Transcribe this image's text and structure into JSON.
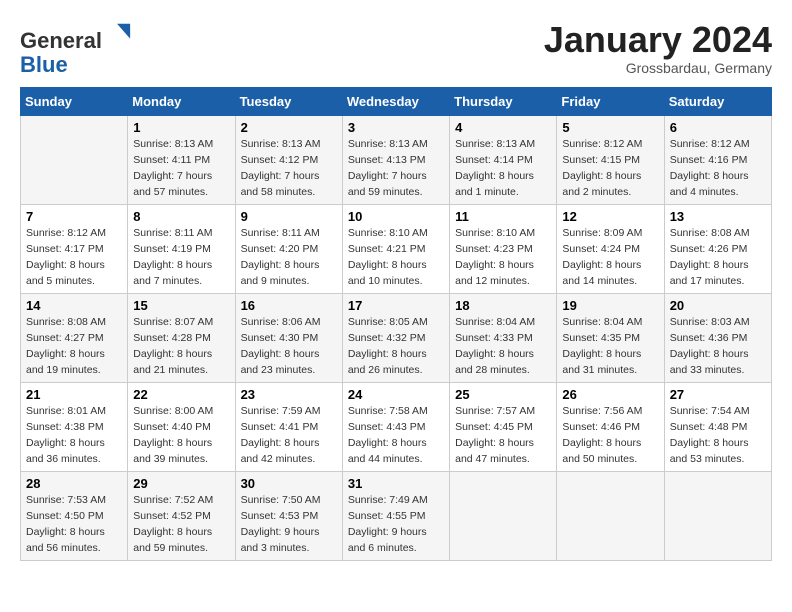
{
  "header": {
    "logo_general": "General",
    "logo_blue": "Blue",
    "month_title": "January 2024",
    "location": "Grossbardau, Germany"
  },
  "columns": [
    "Sunday",
    "Monday",
    "Tuesday",
    "Wednesday",
    "Thursday",
    "Friday",
    "Saturday"
  ],
  "weeks": [
    [
      {
        "day": "",
        "sunrise": "",
        "sunset": "",
        "daylight": ""
      },
      {
        "day": "1",
        "sunrise": "Sunrise: 8:13 AM",
        "sunset": "Sunset: 4:11 PM",
        "daylight": "Daylight: 7 hours and 57 minutes."
      },
      {
        "day": "2",
        "sunrise": "Sunrise: 8:13 AM",
        "sunset": "Sunset: 4:12 PM",
        "daylight": "Daylight: 7 hours and 58 minutes."
      },
      {
        "day": "3",
        "sunrise": "Sunrise: 8:13 AM",
        "sunset": "Sunset: 4:13 PM",
        "daylight": "Daylight: 7 hours and 59 minutes."
      },
      {
        "day": "4",
        "sunrise": "Sunrise: 8:13 AM",
        "sunset": "Sunset: 4:14 PM",
        "daylight": "Daylight: 8 hours and 1 minute."
      },
      {
        "day": "5",
        "sunrise": "Sunrise: 8:12 AM",
        "sunset": "Sunset: 4:15 PM",
        "daylight": "Daylight: 8 hours and 2 minutes."
      },
      {
        "day": "6",
        "sunrise": "Sunrise: 8:12 AM",
        "sunset": "Sunset: 4:16 PM",
        "daylight": "Daylight: 8 hours and 4 minutes."
      }
    ],
    [
      {
        "day": "7",
        "sunrise": "Sunrise: 8:12 AM",
        "sunset": "Sunset: 4:17 PM",
        "daylight": "Daylight: 8 hours and 5 minutes."
      },
      {
        "day": "8",
        "sunrise": "Sunrise: 8:11 AM",
        "sunset": "Sunset: 4:19 PM",
        "daylight": "Daylight: 8 hours and 7 minutes."
      },
      {
        "day": "9",
        "sunrise": "Sunrise: 8:11 AM",
        "sunset": "Sunset: 4:20 PM",
        "daylight": "Daylight: 8 hours and 9 minutes."
      },
      {
        "day": "10",
        "sunrise": "Sunrise: 8:10 AM",
        "sunset": "Sunset: 4:21 PM",
        "daylight": "Daylight: 8 hours and 10 minutes."
      },
      {
        "day": "11",
        "sunrise": "Sunrise: 8:10 AM",
        "sunset": "Sunset: 4:23 PM",
        "daylight": "Daylight: 8 hours and 12 minutes."
      },
      {
        "day": "12",
        "sunrise": "Sunrise: 8:09 AM",
        "sunset": "Sunset: 4:24 PM",
        "daylight": "Daylight: 8 hours and 14 minutes."
      },
      {
        "day": "13",
        "sunrise": "Sunrise: 8:08 AM",
        "sunset": "Sunset: 4:26 PM",
        "daylight": "Daylight: 8 hours and 17 minutes."
      }
    ],
    [
      {
        "day": "14",
        "sunrise": "Sunrise: 8:08 AM",
        "sunset": "Sunset: 4:27 PM",
        "daylight": "Daylight: 8 hours and 19 minutes."
      },
      {
        "day": "15",
        "sunrise": "Sunrise: 8:07 AM",
        "sunset": "Sunset: 4:28 PM",
        "daylight": "Daylight: 8 hours and 21 minutes."
      },
      {
        "day": "16",
        "sunrise": "Sunrise: 8:06 AM",
        "sunset": "Sunset: 4:30 PM",
        "daylight": "Daylight: 8 hours and 23 minutes."
      },
      {
        "day": "17",
        "sunrise": "Sunrise: 8:05 AM",
        "sunset": "Sunset: 4:32 PM",
        "daylight": "Daylight: 8 hours and 26 minutes."
      },
      {
        "day": "18",
        "sunrise": "Sunrise: 8:04 AM",
        "sunset": "Sunset: 4:33 PM",
        "daylight": "Daylight: 8 hours and 28 minutes."
      },
      {
        "day": "19",
        "sunrise": "Sunrise: 8:04 AM",
        "sunset": "Sunset: 4:35 PM",
        "daylight": "Daylight: 8 hours and 31 minutes."
      },
      {
        "day": "20",
        "sunrise": "Sunrise: 8:03 AM",
        "sunset": "Sunset: 4:36 PM",
        "daylight": "Daylight: 8 hours and 33 minutes."
      }
    ],
    [
      {
        "day": "21",
        "sunrise": "Sunrise: 8:01 AM",
        "sunset": "Sunset: 4:38 PM",
        "daylight": "Daylight: 8 hours and 36 minutes."
      },
      {
        "day": "22",
        "sunrise": "Sunrise: 8:00 AM",
        "sunset": "Sunset: 4:40 PM",
        "daylight": "Daylight: 8 hours and 39 minutes."
      },
      {
        "day": "23",
        "sunrise": "Sunrise: 7:59 AM",
        "sunset": "Sunset: 4:41 PM",
        "daylight": "Daylight: 8 hours and 42 minutes."
      },
      {
        "day": "24",
        "sunrise": "Sunrise: 7:58 AM",
        "sunset": "Sunset: 4:43 PM",
        "daylight": "Daylight: 8 hours and 44 minutes."
      },
      {
        "day": "25",
        "sunrise": "Sunrise: 7:57 AM",
        "sunset": "Sunset: 4:45 PM",
        "daylight": "Daylight: 8 hours and 47 minutes."
      },
      {
        "day": "26",
        "sunrise": "Sunrise: 7:56 AM",
        "sunset": "Sunset: 4:46 PM",
        "daylight": "Daylight: 8 hours and 50 minutes."
      },
      {
        "day": "27",
        "sunrise": "Sunrise: 7:54 AM",
        "sunset": "Sunset: 4:48 PM",
        "daylight": "Daylight: 8 hours and 53 minutes."
      }
    ],
    [
      {
        "day": "28",
        "sunrise": "Sunrise: 7:53 AM",
        "sunset": "Sunset: 4:50 PM",
        "daylight": "Daylight: 8 hours and 56 minutes."
      },
      {
        "day": "29",
        "sunrise": "Sunrise: 7:52 AM",
        "sunset": "Sunset: 4:52 PM",
        "daylight": "Daylight: 8 hours and 59 minutes."
      },
      {
        "day": "30",
        "sunrise": "Sunrise: 7:50 AM",
        "sunset": "Sunset: 4:53 PM",
        "daylight": "Daylight: 9 hours and 3 minutes."
      },
      {
        "day": "31",
        "sunrise": "Sunrise: 7:49 AM",
        "sunset": "Sunset: 4:55 PM",
        "daylight": "Daylight: 9 hours and 6 minutes."
      },
      {
        "day": "",
        "sunrise": "",
        "sunset": "",
        "daylight": ""
      },
      {
        "day": "",
        "sunrise": "",
        "sunset": "",
        "daylight": ""
      },
      {
        "day": "",
        "sunrise": "",
        "sunset": "",
        "daylight": ""
      }
    ]
  ]
}
